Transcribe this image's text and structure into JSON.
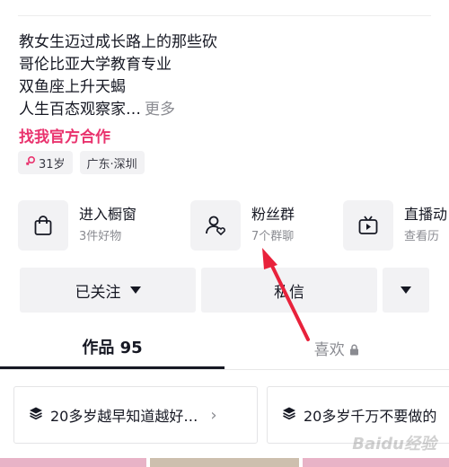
{
  "bio": {
    "lines": [
      "教女生迈过成长路上的那些砍",
      "哥伦比亚大学教育专业",
      "双鱼座上升天蝎",
      "人生百态观察家…"
    ],
    "more_label": "更多",
    "cooperate_label": "找我官方合作"
  },
  "tags": {
    "age_icon": "female-icon",
    "age": "31岁",
    "location": "广东·深圳"
  },
  "features": [
    {
      "icon": "shopping-bag-icon",
      "title": "进入橱窗",
      "subtitle": "3件好物"
    },
    {
      "icon": "fan-group-icon",
      "title": "粉丝群",
      "subtitle": "7个群聊"
    },
    {
      "icon": "tv-play-icon",
      "title": "直播动",
      "subtitle": "查看历"
    }
  ],
  "actions": {
    "followed_label": "已关注",
    "message_label": "私信"
  },
  "tabs": {
    "works_label": "作品 95",
    "likes_label": "喜欢"
  },
  "collections": [
    {
      "icon": "stack-icon",
      "title": "20多岁越早知道越好…"
    },
    {
      "icon": "stack-icon",
      "title": "20多岁千万不要做的"
    }
  ],
  "watermark": "Baidu经验",
  "colors": {
    "accent": "#e9336e",
    "arrow": "#e8223b",
    "muted": "#8a8b91",
    "button_bg": "#f2f2f4"
  }
}
